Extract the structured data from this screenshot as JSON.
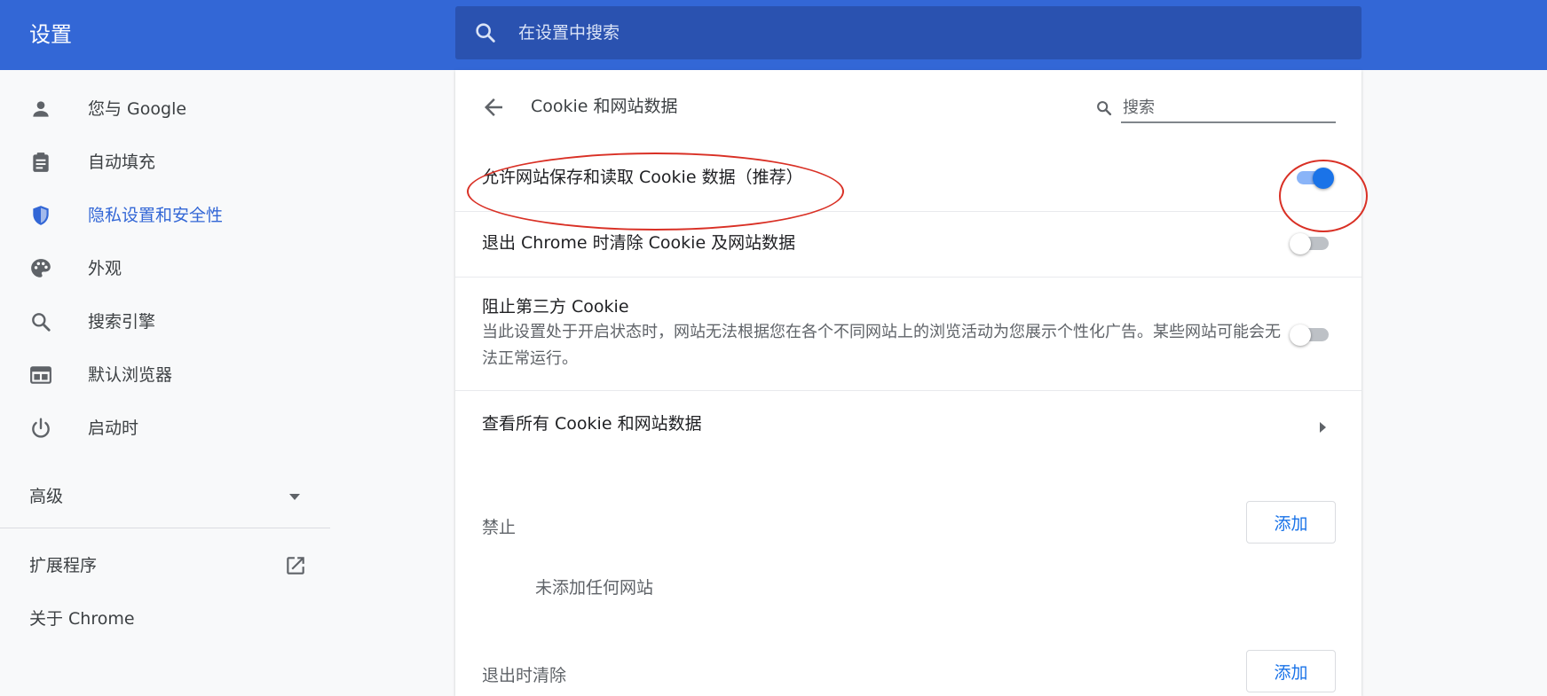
{
  "header": {
    "title": "设置",
    "search_placeholder": "在设置中搜索"
  },
  "sidebar": {
    "items": [
      {
        "label": "您与 Google",
        "icon": "person-icon"
      },
      {
        "label": "自动填充",
        "icon": "clipboard-icon"
      },
      {
        "label": "隐私设置和安全性",
        "icon": "shield-icon",
        "active": true
      },
      {
        "label": "外观",
        "icon": "palette-icon"
      },
      {
        "label": "搜索引擎",
        "icon": "search-icon"
      },
      {
        "label": "默认浏览器",
        "icon": "browser-window-icon"
      },
      {
        "label": "启动时",
        "icon": "power-icon"
      }
    ],
    "advanced_label": "高级",
    "extensions_label": "扩展程序",
    "about_label": "关于 Chrome"
  },
  "page": {
    "title": "Cookie 和网站数据",
    "search_placeholder": "搜索",
    "settings": [
      {
        "label": "允许网站保存和读取 Cookie 数据（推荐）",
        "enabled": true
      },
      {
        "label": "退出 Chrome 时清除 Cookie 及网站数据",
        "enabled": false
      },
      {
        "label": "阻止第三方 Cookie",
        "description": "当此设置处于开启状态时，网站无法根据您在各个不同网站上的浏览活动为您展示个性化广告。某些网站可能会无法正常运行。",
        "enabled": false
      }
    ],
    "view_all_label": "查看所有 Cookie 和网站数据",
    "block_section": {
      "title": "禁止",
      "add_label": "添加",
      "empty_text": "未添加任何网站"
    },
    "clear_on_exit_section": {
      "title": "退出时清除",
      "add_label": "添加"
    }
  },
  "colors": {
    "header_bg": "#3367d6",
    "search_bg": "#2a52b0",
    "accent": "#1a73e8",
    "annotation": "#d93025"
  }
}
